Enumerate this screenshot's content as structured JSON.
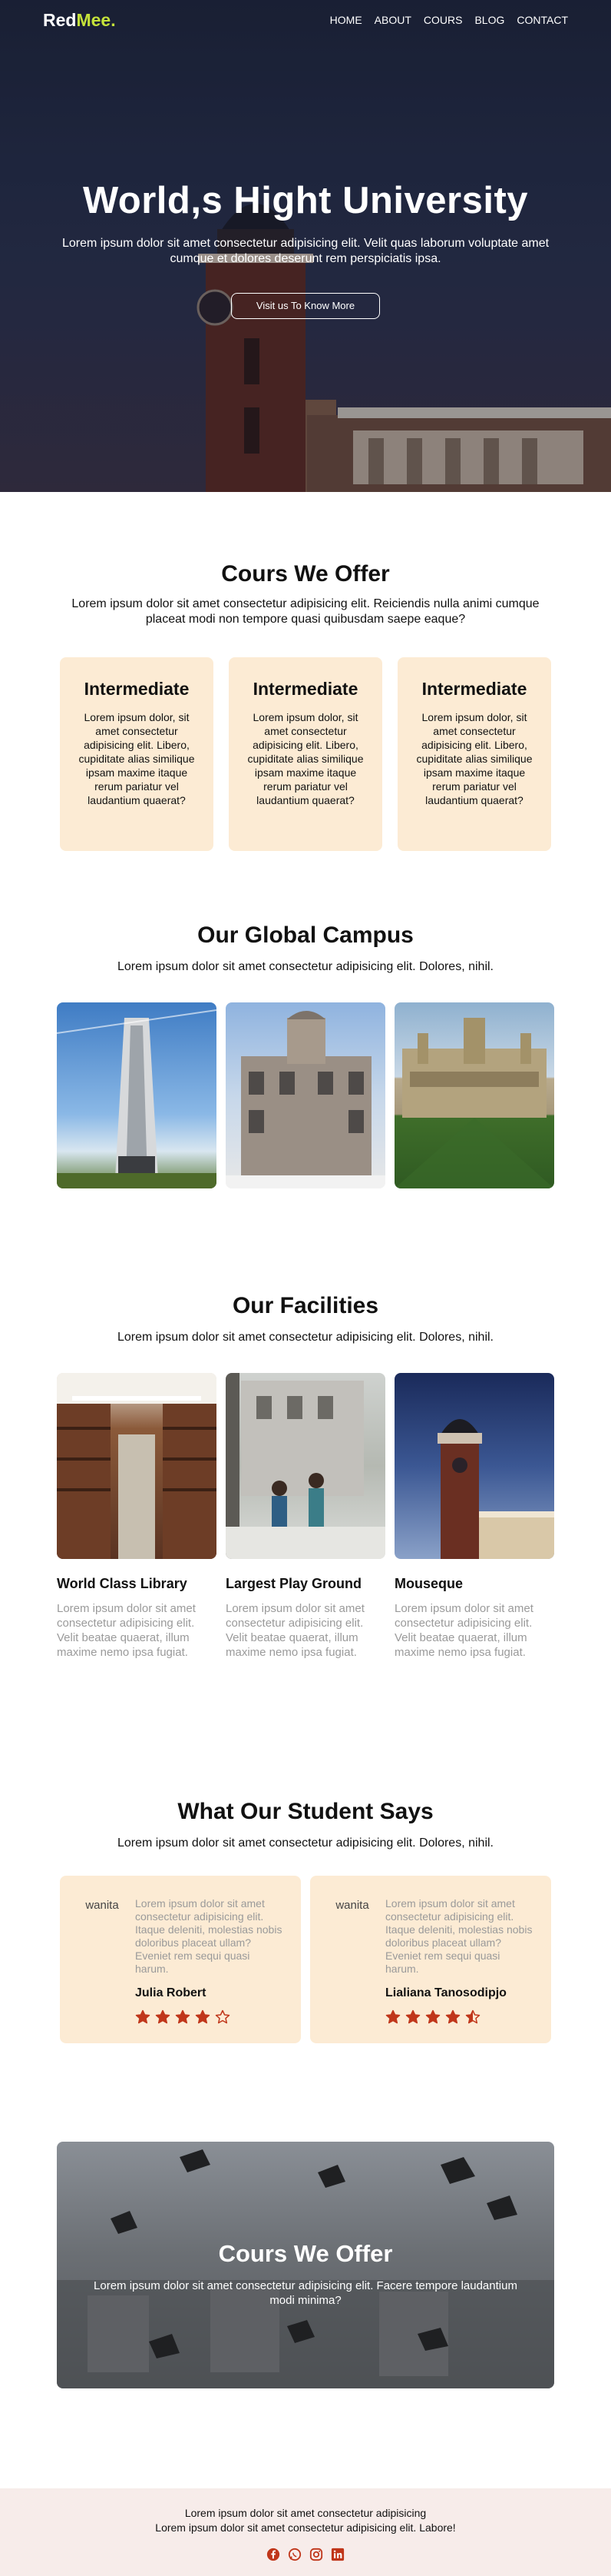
{
  "nav": {
    "logo_main": "Red",
    "logo_accent": "Mee.",
    "items": [
      "HOME",
      "ABOUT",
      "COURS",
      "BLOG",
      "CONTACT"
    ]
  },
  "hero": {
    "title": "World,s Hight University",
    "text": "Lorem ipsum dolor sit amet consectetur adipisicing elit. Velit quas laborum voluptate amet cumque et dolores deserunt rem perspiciatis ipsa.",
    "button": "Visit us To Know More"
  },
  "courses": {
    "title": "Cours We Offer",
    "subtitle": "Lorem ipsum dolor sit amet consectetur adipisicing elit. Reiciendis nulla animi cumque placeat modi non tempore quasi quibusdam saepe eaque?",
    "cards": [
      {
        "title": "Intermediate",
        "text": "Lorem ipsum dolor, sit amet consectetur adipisicing elit. Libero, cupiditate alias similique ipsam maxime itaque rerum pariatur vel laudantium quaerat?"
      },
      {
        "title": "Intermediate",
        "text": "Lorem ipsum dolor, sit amet consectetur adipisicing elit. Libero, cupiditate alias similique ipsam maxime itaque rerum pariatur vel laudantium quaerat?"
      },
      {
        "title": "Intermediate",
        "text": "Lorem ipsum dolor, sit amet consectetur adipisicing elit. Libero, cupiditate alias similique ipsam maxime itaque rerum pariatur vel laudantium quaerat?"
      }
    ]
  },
  "campus": {
    "title": "Our Global Campus",
    "subtitle": "Lorem ipsum dolor sit amet consectetur adipisicing elit. Dolores, nihil."
  },
  "facilities": {
    "title": "Our Facilities",
    "subtitle": "Lorem ipsum dolor sit amet consectetur adipisicing elit. Dolores, nihil.",
    "items": [
      {
        "title": "World Class Library",
        "text": "Lorem ipsum dolor sit amet consectetur adipisicing elit. Velit beatae quaerat, illum maxime nemo ipsa fugiat."
      },
      {
        "title": "Largest Play Ground",
        "text": "Lorem ipsum dolor sit amet consectetur adipisicing elit. Velit beatae quaerat, illum maxime nemo ipsa fugiat."
      },
      {
        "title": "Mouseque",
        "text": "Lorem ipsum dolor sit amet consectetur adipisicing elit. Velit beatae quaerat, illum maxime nemo ipsa fugiat."
      }
    ]
  },
  "testimonials": {
    "title": "What Our Student Says",
    "subtitle": "Lorem ipsum dolor sit amet consectetur adipisicing elit. Dolores, nihil.",
    "cards": [
      {
        "avatar_alt": "wanita",
        "text": "Lorem ipsum dolor sit amet consectetur adipisicing elit. Itaque deleniti, molestias nobis doloribus placeat ullam? Eveniet rem sequi quasi harum.",
        "name": "Julia Robert",
        "rating": 4
      },
      {
        "avatar_alt": "wanita",
        "text": "Lorem ipsum dolor sit amet consectetur adipisicing elit. Itaque deleniti, molestias nobis doloribus placeat ullam? Eveniet rem sequi quasi harum.",
        "name": "Lialiana Tanosodipjo",
        "rating": 4.5
      }
    ]
  },
  "cta": {
    "title": "Cours We Offer",
    "text": "Lorem ipsum dolor sit amet consectetur adipisicing elit. Facere tempore laudantium modi minima?"
  },
  "footer": {
    "line1": "Lorem ipsum dolor sit amet consectetur adipisicing",
    "line2": "Lorem ipsum dolor sit amet consectetur adipisicing elit. Labore!",
    "socials": [
      "facebook-icon",
      "whatsapp-icon",
      "instagram-icon",
      "linkedin-icon"
    ]
  },
  "colors": {
    "accent": "#c5e23a",
    "card_bg": "#fcebd4",
    "star": "#c0361a",
    "social": "#c0361a",
    "footer_bg": "#f7ecea"
  }
}
